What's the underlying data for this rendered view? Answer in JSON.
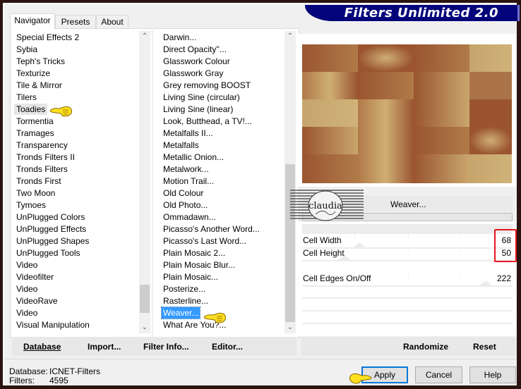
{
  "window": {
    "title": "Filters Unlimited 2.0"
  },
  "tabs": [
    {
      "label": "Navigator",
      "active": true
    },
    {
      "label": "Presets",
      "active": false
    },
    {
      "label": "About",
      "active": false
    }
  ],
  "categories": {
    "items": [
      "Special Effects 2",
      "Sybia",
      "Teph's Tricks",
      "Texturize",
      "Tile & Mirror",
      "Tilers",
      "Toadies",
      "Tormentia",
      "Tramages",
      "Transparency",
      "Tronds Filters II",
      "Tronds Filters",
      "Tronds First",
      "Two Moon",
      "Tymoes",
      "UnPlugged Colors",
      "UnPlugged Effects",
      "UnPlugged Shapes",
      "UnPlugged Tools",
      "Video",
      "Videofilter",
      "Video",
      "VideoRave",
      "Video",
      "Visual Manipulation"
    ],
    "highlighted": "Toadies",
    "scroll_position": 0.92
  },
  "filters": {
    "items": [
      "Darwin...",
      "Direct Opacity''...",
      "Glasswork Colour",
      "Glasswork Gray",
      "Grey removing BOOST",
      "Living Sine (circular)",
      "Living Sine (linear)",
      "Look, Butthead, a TV!...",
      "Metalfalls II...",
      "Metalfalls",
      "Metallic Onion...",
      "Metalwork...",
      "Motion Trail...",
      "Old Colour",
      "Old Photo...",
      "Ommadawn...",
      "Picasso's Another Word...",
      "Picasso's Last Word...",
      "Plain Mosaic 2...",
      "Plain Mosaic Blur...",
      "Plain Mosaic...",
      "Posterize...",
      "Rasterline...",
      "Weaver...",
      "What Are You?..."
    ],
    "selected": "Weaver...",
    "scroll_position": 1.0
  },
  "left_buttons": {
    "database": "Database",
    "import": "Import...",
    "filter_info": "Filter Info...",
    "editor": "Editor..."
  },
  "preview": {
    "description": "woven copper and tan tile pattern preview",
    "colors": [
      "#9a5530",
      "#c4a46a",
      "#b07a48",
      "#d0b278"
    ]
  },
  "filter_panel": {
    "logo_text": "claudia",
    "filter_name": "Weaver...",
    "params": [
      {
        "name": "Cell Width",
        "value": "68",
        "slider": 0.27
      },
      {
        "name": "Cell Height",
        "value": "50",
        "slider": 0.2
      },
      {
        "name": "Cell Edges On/Off",
        "value": "222",
        "slider": 0.87
      }
    ],
    "highlighted_params": [
      "Cell Width",
      "Cell Height"
    ],
    "accent_color": "#e8141c"
  },
  "right_buttons": {
    "randomize": "Randomize",
    "reset": "Reset"
  },
  "status": {
    "database_label": "Database:",
    "database_value": "ICNET-Filters",
    "filters_label": "Filters:",
    "filters_value": "4595"
  },
  "dialog_buttons": {
    "apply": "Apply",
    "cancel": "Cancel",
    "help": "Help"
  }
}
